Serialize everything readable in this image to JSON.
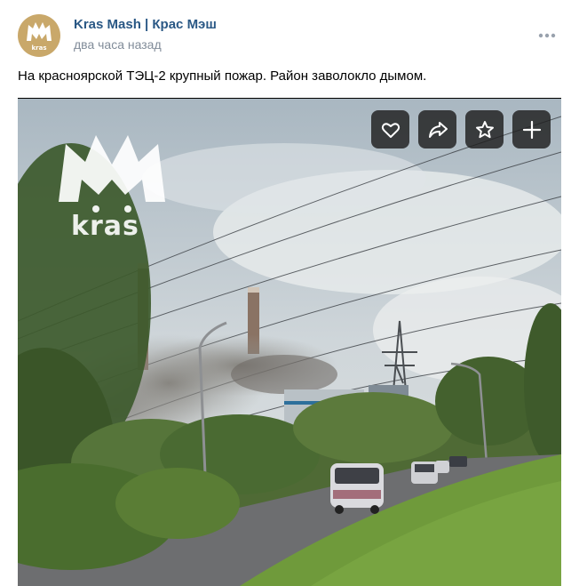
{
  "post": {
    "author": "Kras Mash | Крас Мэш",
    "time": "два часа назад",
    "text": "На красноярской ТЭЦ-2 крупный пожар. Район заволокло дымом.",
    "avatar_logo_text": "kras"
  },
  "media": {
    "watermark_text": "kras",
    "actions": [
      {
        "name": "like",
        "icon": "heart-icon"
      },
      {
        "name": "share",
        "icon": "share-icon"
      },
      {
        "name": "favorite",
        "icon": "star-icon"
      },
      {
        "name": "add",
        "icon": "plus-icon"
      }
    ]
  },
  "colors": {
    "author_link": "#2a5885",
    "secondary_text": "#818c99",
    "avatar_bg": "#c9a86a"
  }
}
